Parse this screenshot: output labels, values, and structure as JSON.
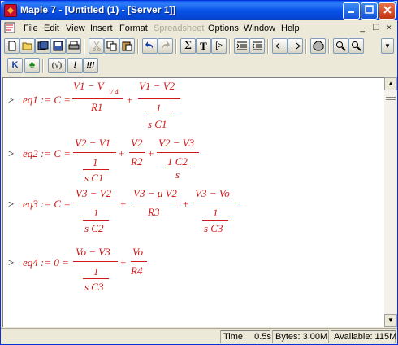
{
  "window": {
    "title": "Maple 7  - [Untitled (1) - [Server 1]]"
  },
  "menu": {
    "items": [
      "File",
      "Edit",
      "View",
      "Insert",
      "Format",
      "Spreadsheet",
      "Options",
      "Window",
      "Help"
    ]
  },
  "toolbar2": {
    "items": [
      "K",
      "♣",
      "(√)",
      "!",
      "!!!"
    ]
  },
  "worksheet": {
    "prompt": ">",
    "eq1": {
      "lhs": "eq1 := C =",
      "num1": "V1 − V",
      "num1_sub": "\\/ 4",
      "den1": "R1",
      "plus": "+",
      "num2": "V1 − V2",
      "inner_num": "1",
      "inner_den": "s C1"
    },
    "eq2": {
      "lhs": "eq2 := C =",
      "num1": "V2 − V1",
      "inner_num": "1",
      "inner_den": "s C1",
      "plus1": "+",
      "num2": "V2",
      "den2": "R2",
      "plus2": "+",
      "num3": "V2 − V3",
      "inner_num3": "1 C2",
      "inner_den3": "s"
    },
    "eq3": {
      "lhs": "eq3 := C =",
      "num1": "V3 − V2",
      "inner_num": "1",
      "inner_den": "s C2",
      "plus1": "+",
      "num2": "V3 − μ V2",
      "den2": "R3",
      "plus2": "+",
      "num3": "V3 − Vo",
      "inner_num3": "1",
      "inner_den3": "s C3"
    },
    "eq4": {
      "lhs": "eq4 := 0 =",
      "num1": "Vo − V3",
      "inner_num": "1",
      "inner_den": "s C3",
      "plus1": "+",
      "num2": "Vo",
      "den2": "R4"
    }
  },
  "status": {
    "time_label": "Time:",
    "time_value": "0.5s",
    "bytes": "Bytes: 3.00M",
    "available": "Available: 115M"
  }
}
